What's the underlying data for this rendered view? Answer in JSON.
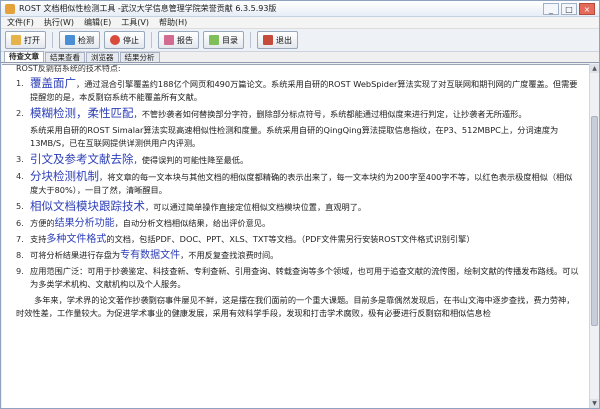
{
  "window": {
    "title": "ROST 文档相似性检测工具 -武汉大学信息管理学院荣誉贡献 6.3.5.93版",
    "controls": [
      "_",
      "□",
      "×"
    ]
  },
  "menu": [
    "文件(F)",
    "执行(W)",
    "编辑(E)",
    "工具(V)",
    "帮助(H)"
  ],
  "toolbar": {
    "open": "打开",
    "check": "检测",
    "stop": "停止",
    "report": "报告",
    "directory": "目录",
    "exit": "退出"
  },
  "tabs": [
    "待查文章",
    "结果查看",
    "浏览器",
    "结果分析"
  ],
  "doc": {
    "intro_cut": "ROST反剽窃系统的技术特点:",
    "items": [
      {
        "num": "1.",
        "kw": "覆盖面广",
        "text": "，通过混合引擎覆盖约188亿个网页和490万篇论文。系统采用自研的ROST WebSpider算法实现了对互联网和期刊网的广度覆盖。但需要提醒您的是，本反剽窃系统不能覆盖所有文献。"
      },
      {
        "num": "2.",
        "kw": "模糊检测，柔性匹配",
        "text": "，不管抄袭者如何替换部分字符，删除部分标点符号，系统都能通过相似度来进行判定，让抄袭者无所遁形。"
      },
      {
        "num": "",
        "kw": "",
        "text": "系统采用自研的ROST Simalar算法实现高速相似性检测和度量。系统采用自研的QingQing算法提取信息指纹，在P3、512MBPC上，分词速度为13MB/S，已在互联网提供详测供用户内评测。"
      },
      {
        "num": "3.",
        "kw": "引文及参考文献去除",
        "text": "，使得误判的可能性降至最低。"
      },
      {
        "num": "4.",
        "kw": "分块检测机制",
        "text": "，将文章的每一文本块与其他文档的相似度都精确的表示出来了，每一文本块约为200字至400字不等，以红色表示极度相似（相似度大于80%），一目了然，清晰醒目。"
      },
      {
        "num": "5.",
        "kw": "相似文档模块跟踪技术",
        "text": "，可以通过简单操作直接定位相似文档模块位置，直观明了。"
      },
      {
        "num": "6.",
        "pre": "方便的",
        "kw": "结果分析功能",
        "text": "，自动分析文档相似结果，给出评价意见。"
      },
      {
        "num": "7.",
        "pre": "支持",
        "kw": "多种文件格式",
        "text": "的文档，包括PDF、DOC、PPT、XLS、TXT等文档。（PDF文件需另行安装ROST文件格式识别引擎）"
      },
      {
        "num": "8.",
        "pre": "可将分析结果进行存盘为",
        "kw": "专有数据文件",
        "text": "，不用反复查找浪费时间。"
      },
      {
        "num": "9.",
        "kw": "",
        "text": "应用范围广泛：可用于抄袭鉴定、科技查新、专利查新、引用查询、转载查询等多个领域，也可用于追查文献的流传图，绘制文献的传播发布路线。可以为多类学术机构、文献机构以及个人服务。"
      }
    ],
    "closing": "多年来，学术界的论文著作抄袭剽窃事件屡见不鲜，这是摆在我们面前的一个重大课题。目前多是靠偶然发现后，在书山文海中逐步查找，费力劳神，时效性差，工作量较大。为促进学术事业的健康发展，采用有效科学手段，发现和打击学术腐败，极有必要进行反剽窃和相似信息检"
  }
}
